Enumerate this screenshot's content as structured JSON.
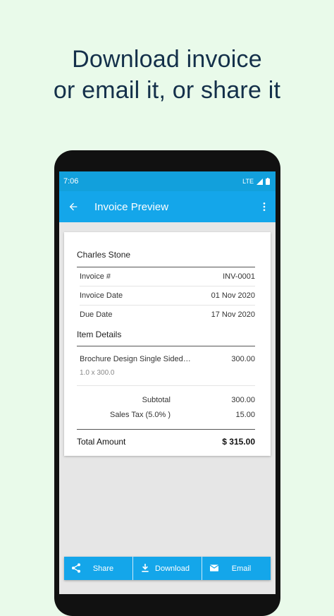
{
  "headline": {
    "line1": "Download invoice",
    "line2": "or email it, or share it"
  },
  "status_bar": {
    "time": "7:06",
    "network": "LTE"
  },
  "app_bar": {
    "title": "Invoice Preview"
  },
  "invoice": {
    "customer_name": "Charles Stone",
    "details": [
      {
        "label": "Invoice #",
        "value": "INV-0001"
      },
      {
        "label": "Invoice Date",
        "value": "01 Nov 2020"
      },
      {
        "label": "Due Date",
        "value": "17 Nov 2020"
      }
    ],
    "item_section_title": "Item Details",
    "items": [
      {
        "name": "Brochure Design Single Sided…",
        "amount": "300.00",
        "qty_rate": "1.0 x 300.0"
      }
    ],
    "subtotal": {
      "label": "Subtotal",
      "value": "300.00"
    },
    "tax": {
      "label": "Sales Tax (5.0% )",
      "value": "15.00"
    },
    "total": {
      "label": "Total Amount",
      "value": "$ 315.00"
    }
  },
  "actions": {
    "share": "Share",
    "download": "Download",
    "email": "Email"
  },
  "colors": {
    "background": "#e9faea",
    "headline": "#14304a",
    "app_bar": "#14a6ea",
    "status_bar": "#12a0dc"
  }
}
